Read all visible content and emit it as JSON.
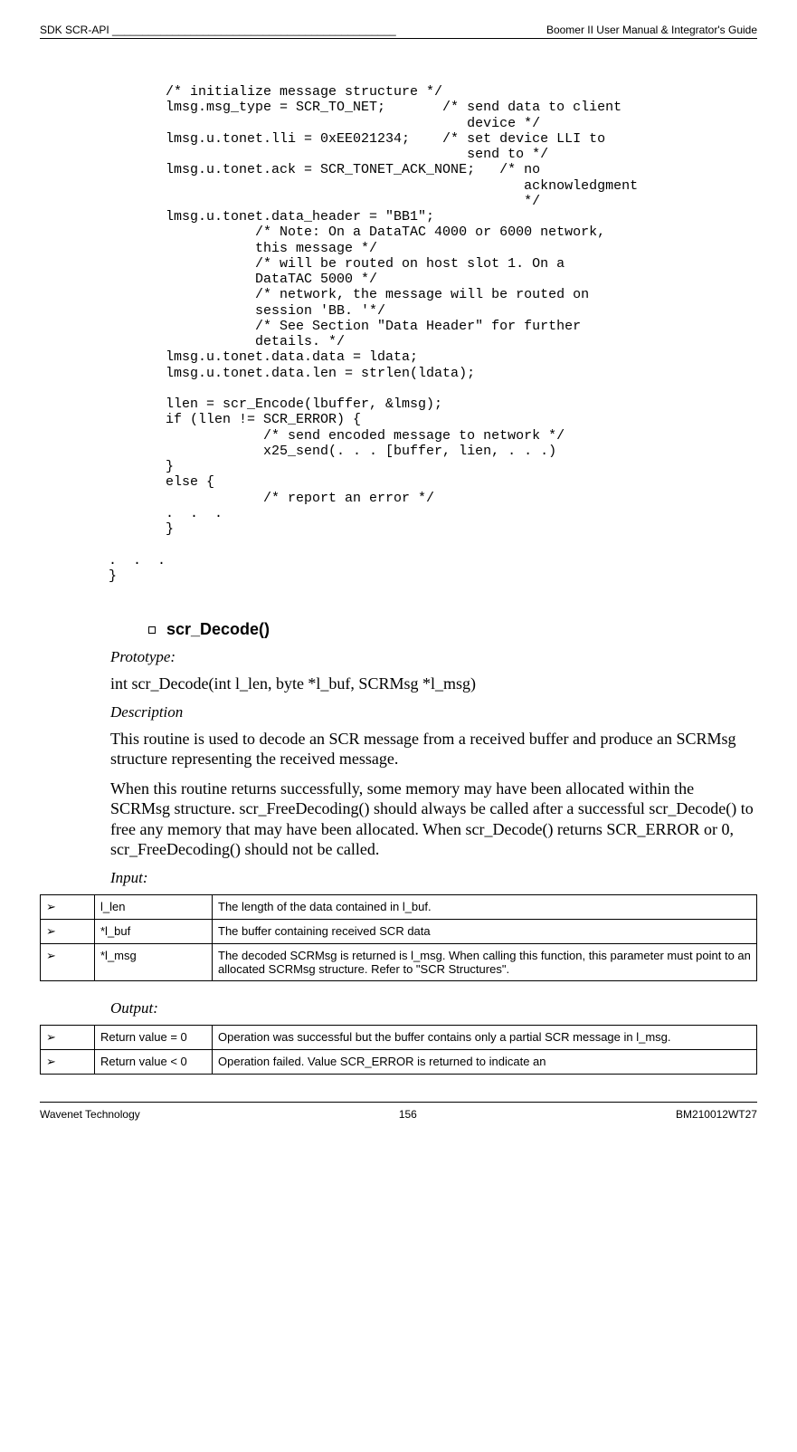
{
  "header": {
    "left": "SDK SCR-API _______________________________________________",
    "right": "Boomer II User Manual & Integrator's Guide"
  },
  "code": "       /* initialize message structure */\n       lmsg.msg_type = SCR_TO_NET;       /* send data to client\n                                            device */\n       lmsg.u.tonet.lli = 0xEE021234;    /* set device LLI to\n                                            send to */\n       lmsg.u.tonet.ack = SCR_TONET_ACK_NONE;   /* no\n                                                   acknowledgment\n                                                   */\n       lmsg.u.tonet.data_header = \"BB1\";\n                  /* Note: On a DataTAC 4000 or 6000 network,\n                  this message */\n                  /* will be routed on host slot 1. On a\n                  DataTAC 5000 */\n                  /* network, the message will be routed on\n                  session 'BB. '*/\n                  /* See Section \"Data Header\" for further\n                  details. */\n       lmsg.u.tonet.data.data = ldata;\n       lmsg.u.tonet.data.len = strlen(ldata);\n\n       llen = scr_Encode(lbuffer, &lmsg);\n       if (llen != SCR_ERROR) {\n                   /* send encoded message to network */\n                   x25_send(. . . [buffer, lien, . . .)\n       }\n       else {\n                   /* report an error */\n       .  .  .\n       }\n\n.  .  .\n}",
  "section": {
    "heading": "scr_Decode()",
    "prototype_label": "Prototype:",
    "prototype": "int scr_Decode(int l_len, byte *l_buf, SCRMsg *l_msg)",
    "description_label": "Description",
    "description_p1": "This routine is used to decode an SCR message from a received buffer and produce an SCRMsg structure representing the received message.",
    "description_p2": "When this routine returns successfully, some memory may have been allocated within the SCRMsg structure. scr_FreeDecoding() should always be called after a successful scr_Decode() to free any memory that may have been allocated. When scr_Decode() returns SCR_ERROR or 0, scr_FreeDecoding() should not be called.",
    "input_label": "Input:",
    "input_rows": [
      {
        "sym": "➢",
        "name": "l_len",
        "desc": "The length of the data contained in l_buf."
      },
      {
        "sym": "➢",
        "name": "*l_buf",
        "desc": "The buffer containing received SCR data"
      },
      {
        "sym": "➢",
        "name": "*l_msg",
        "desc": "The decoded SCRMsg is returned is l_msg. When calling this function, this parameter must point to an allocated SCRMsg structure. Refer to \"SCR Structures\"."
      }
    ],
    "output_label": "Output:",
    "output_rows": [
      {
        "sym": "➢",
        "name": "Return value = 0",
        "desc": "Operation was successful but the buffer contains only a partial SCR message  in l_msg."
      },
      {
        "sym": "➢",
        "name": "Return value  < 0",
        "desc": "Operation failed. Value SCR_ERROR is returned to indicate an"
      }
    ]
  },
  "footer": {
    "left": "Wavenet Technology",
    "center": "156",
    "right": "BM210012WT27"
  }
}
